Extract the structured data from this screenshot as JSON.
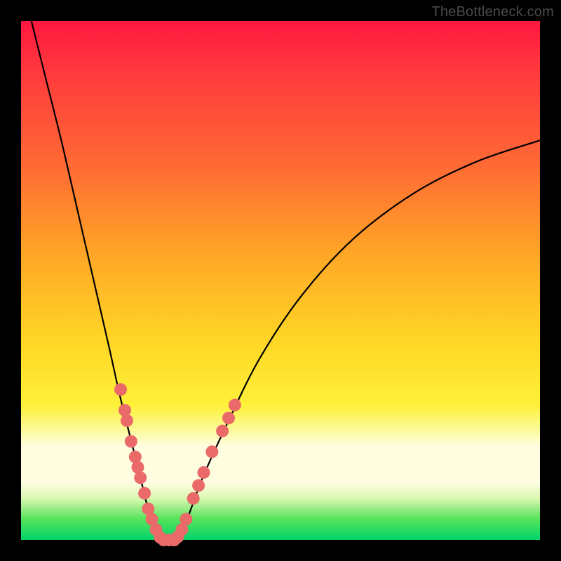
{
  "watermark": "TheBottleneck.com",
  "chart_data": {
    "type": "line",
    "title": "",
    "xlabel": "",
    "ylabel": "",
    "xlim": [
      0,
      100
    ],
    "ylim": [
      0,
      100
    ],
    "grid": false,
    "legend": false,
    "series": [
      {
        "name": "left-curve",
        "x": [
          2,
          5,
          8,
          11,
          14,
          17,
          19,
          21,
          23,
          24.5,
          26,
          27
        ],
        "y": [
          100,
          88,
          76,
          63,
          50,
          37,
          28,
          20,
          12,
          6,
          2,
          0
        ]
      },
      {
        "name": "valley-floor",
        "x": [
          27,
          30
        ],
        "y": [
          0,
          0
        ]
      },
      {
        "name": "right-curve",
        "x": [
          30,
          32,
          35,
          40,
          46,
          54,
          64,
          76,
          88,
          100
        ],
        "y": [
          0,
          4,
          12,
          23,
          35,
          47,
          58,
          67,
          73,
          77
        ]
      }
    ],
    "points_overlay": {
      "name": "highlight-dots",
      "color": "#ea6a6a",
      "left_cluster": [
        {
          "x": 19.2,
          "y": 29
        },
        {
          "x": 20.0,
          "y": 25
        },
        {
          "x": 20.4,
          "y": 23
        },
        {
          "x": 21.2,
          "y": 19
        },
        {
          "x": 22.0,
          "y": 16
        },
        {
          "x": 22.5,
          "y": 14
        },
        {
          "x": 23.0,
          "y": 12
        },
        {
          "x": 23.8,
          "y": 9
        },
        {
          "x": 24.5,
          "y": 6
        },
        {
          "x": 25.2,
          "y": 4
        },
        {
          "x": 26.0,
          "y": 2
        },
        {
          "x": 26.8,
          "y": 0.5
        }
      ],
      "floor_cluster": [
        {
          "x": 27.5,
          "y": 0
        },
        {
          "x": 28.5,
          "y": 0
        },
        {
          "x": 29.5,
          "y": 0
        }
      ],
      "right_cluster": [
        {
          "x": 30.2,
          "y": 0.6
        },
        {
          "x": 31.0,
          "y": 2
        },
        {
          "x": 31.8,
          "y": 4
        },
        {
          "x": 33.2,
          "y": 8
        },
        {
          "x": 34.2,
          "y": 10.5
        },
        {
          "x": 35.2,
          "y": 13
        },
        {
          "x": 36.8,
          "y": 17
        },
        {
          "x": 38.8,
          "y": 21
        },
        {
          "x": 40.0,
          "y": 23.5
        },
        {
          "x": 41.2,
          "y": 26
        }
      ]
    },
    "background_bands": [
      {
        "name": "red",
        "from": 100,
        "to": 74,
        "color_top": "#ff173f",
        "color_bottom": "#ff6a34"
      },
      {
        "name": "orange",
        "from": 74,
        "to": 45,
        "color_top": "#ff6a34",
        "color_bottom": "#ffd726"
      },
      {
        "name": "yellow",
        "from": 45,
        "to": 20,
        "color_top": "#ffd726",
        "color_bottom": "#fbf98a"
      },
      {
        "name": "pale-band",
        "from": 20,
        "to": 10,
        "color_top": "#fbf98a",
        "color_bottom": "#fffde0"
      },
      {
        "name": "green",
        "from": 10,
        "to": 0,
        "color_top": "#d9f7b0",
        "color_bottom": "#00d46a"
      }
    ]
  }
}
